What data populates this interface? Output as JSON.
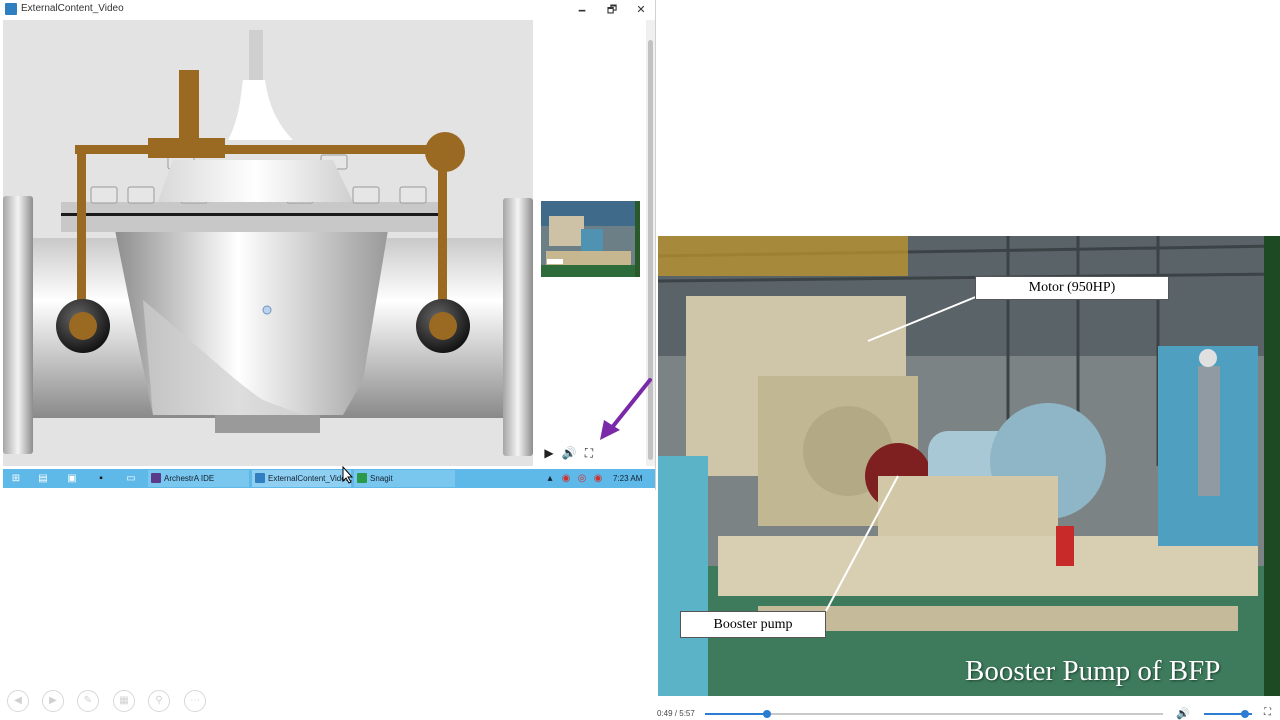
{
  "window": {
    "title": "ExternalContent_Video",
    "minimize_glyph": "🗕",
    "maximize_glyph": "🗗",
    "close_glyph": "✕"
  },
  "video_controls": {
    "play_icon": "play-icon",
    "volume_icon": "volume-icon",
    "fullscreen_icon": "fullscreen-icon"
  },
  "taskbar": {
    "items": [
      {
        "label": "ArchestrA IDE"
      },
      {
        "label": "ExternalContent_Vide..."
      },
      {
        "label": "Snagit"
      }
    ],
    "clock": "7:23 AM",
    "color": "#5fb9e8"
  },
  "video": {
    "callout_motor": "Motor (950HP)",
    "callout_booster": "Booster pump",
    "caption": "Booster Pump of BFP",
    "time": "0:49 / 5:57",
    "progress": 0.136,
    "volume": 0.85
  },
  "colors": {
    "valve_actuator": "#9a6a22",
    "annotation_arrow": "#7a2aa8",
    "player_accent": "#2b7cd3"
  }
}
